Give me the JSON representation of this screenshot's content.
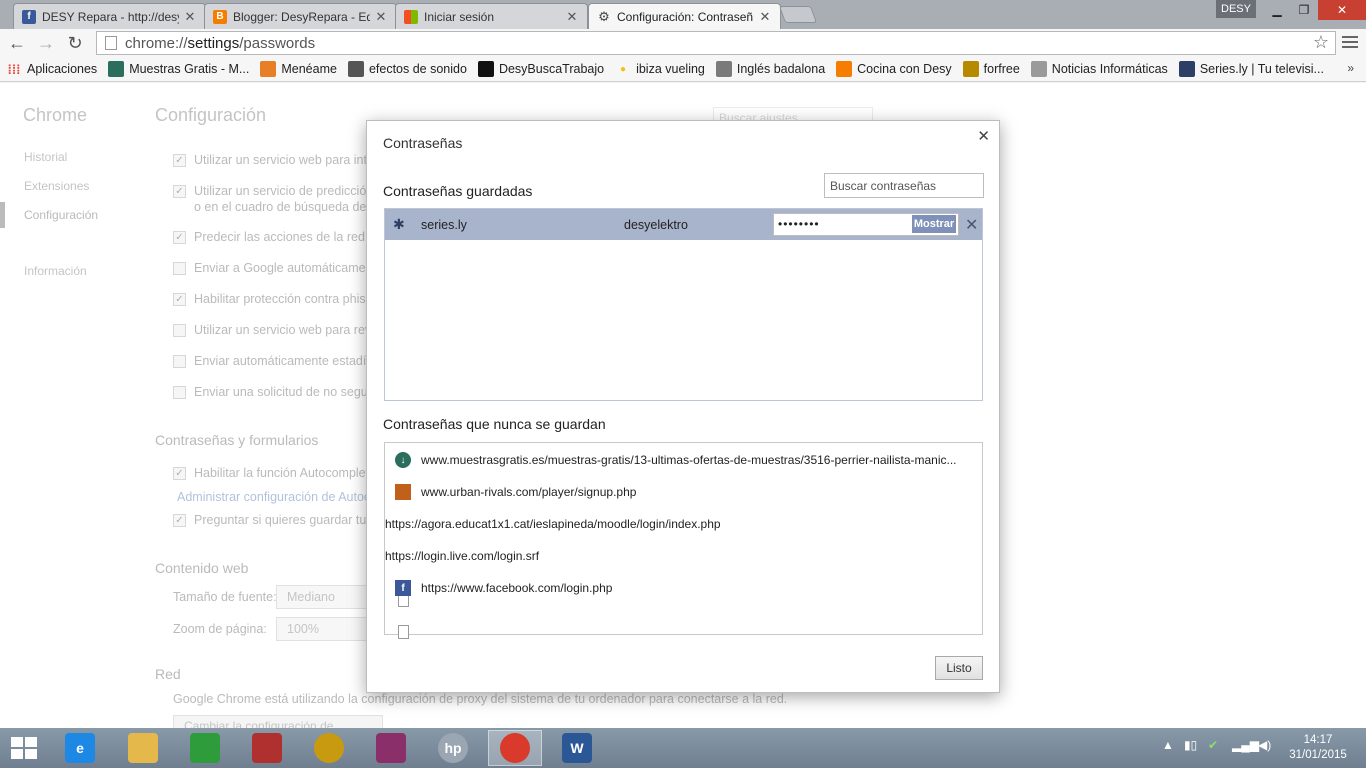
{
  "tabs": [
    {
      "title": "DESY Repara - http://desy",
      "icon": "facebook-icon",
      "color": "#3b5998",
      "active": false
    },
    {
      "title": "Blogger: DesyRepara - Edit",
      "icon": "blogger-icon",
      "color": "#f57d00",
      "active": false
    },
    {
      "title": "Iniciar sesión",
      "icon": "microsoft-icon",
      "color": "#0078d7",
      "active": false
    },
    {
      "title": "Configuración: Contraseñ",
      "icon": "gear-icon",
      "color": "#555555",
      "active": true
    }
  ],
  "profile_name": "DESY",
  "address": {
    "scheme": "chrome://",
    "host": "settings",
    "path": "/passwords"
  },
  "bookmarks": [
    {
      "label": "Aplicaciones",
      "icon": "apps-grid-icon",
      "color": "#e94235"
    },
    {
      "label": "Muestras Gratis - M...",
      "icon": "muestras-icon",
      "color": "#2b6e5e"
    },
    {
      "label": "Menéame",
      "icon": "meneame-icon",
      "color": "#e67f26"
    },
    {
      "label": "efectos de sonido",
      "icon": "sound-icon",
      "color": "#555555"
    },
    {
      "label": "DesyBuscaTrabajo",
      "icon": "black-square-icon",
      "color": "#111111"
    },
    {
      "label": "ibiza vueling",
      "icon": "yellow-dot-icon",
      "color": "#f4c20d"
    },
    {
      "label": "Inglés badalona",
      "icon": "english-icon",
      "color": "#7a7a7a"
    },
    {
      "label": "Cocina con Desy",
      "icon": "blogger-icon",
      "color": "#f57d00"
    },
    {
      "label": "forfree",
      "icon": "crown-icon",
      "color": "#b58a00"
    },
    {
      "label": "Noticias Informáticas",
      "icon": "page-icon",
      "color": "#9a9a9a"
    },
    {
      "label": "Series.ly | Tu televisi...",
      "icon": "seriesly-icon",
      "color": "#2d3f66"
    }
  ],
  "sidebar": {
    "brand": "Chrome",
    "items": [
      {
        "label": "Historial"
      },
      {
        "label": "Extensiones"
      },
      {
        "label": "Configuración"
      },
      {
        "label": "Información"
      }
    ]
  },
  "settings": {
    "title": "Configuración",
    "search_placeholder": "Buscar ajustes",
    "privacy_options": [
      {
        "label": "Utilizar un servicio web para inte",
        "checked": true
      },
      {
        "label": "Utilizar un servicio de predicción",
        "label2": "o en el cuadro de búsqueda del",
        "checked": true
      },
      {
        "label": "Predecir las acciones de la red pa",
        "checked": true
      },
      {
        "label": "Enviar a Google automáticament",
        "checked": false
      },
      {
        "label": "Habilitar protección contra phish",
        "checked": true
      },
      {
        "label": "Utilizar un servicio web para revi",
        "checked": false
      },
      {
        "label": "Enviar automáticamente estadíst",
        "checked": false
      },
      {
        "label": "Enviar una solicitud de no segui",
        "checked": false
      }
    ],
    "passwords_section": "Contraseñas y formularios",
    "autofill_option": "Habilitar la función Autocomplet",
    "autofill_link": "Administrar configuración de Autoc",
    "save_pw_option": "Preguntar si quieres guardar tus",
    "web_content_section": "Contenido web",
    "font_size_label": "Tamaño de fuente:",
    "font_size_value": "Mediano",
    "zoom_label": "Zoom de página:",
    "zoom_value": "100%",
    "network_section": "Red",
    "network_note": "Google Chrome está utilizando la configuración de proxy del sistema de tu ordenador para conectarse a la red.",
    "proxy_button": "Cambiar la configuración de proxy..."
  },
  "dialog": {
    "title": "Contraseñas",
    "saved_heading": "Contraseñas guardadas",
    "search_placeholder": "Buscar contraseñas",
    "saved": [
      {
        "site": "series.ly",
        "username": "desyelektro",
        "password_mask": "••••••••",
        "show_label": "Mostrar"
      }
    ],
    "never_heading": "Contraseñas que nunca se guardan",
    "never_saved": [
      {
        "url": "www.muestrasgratis.es/muestras-gratis/13-ultimas-ofertas-de-muestras/3516-perrier-nailista-manic...",
        "icon": "muestras-icon",
        "color": "#2b6e5e"
      },
      {
        "url": "www.urban-rivals.com/player/signup.php",
        "icon": "urban-rivals-icon",
        "color": "#c0601a"
      },
      {
        "url": "https://agora.educat1x1.cat/ieslapineda/moodle/login/index.php",
        "icon": "page-icon",
        "color": "#ffffff"
      },
      {
        "url": "https://login.live.com/login.srf",
        "icon": "page-icon",
        "color": "#ffffff"
      },
      {
        "url": "https://www.facebook.com/login.php",
        "icon": "facebook-icon",
        "color": "#3b5998"
      }
    ],
    "ok_label": "Listo"
  },
  "taskbar": {
    "apps": [
      {
        "name": "internet-explorer-icon",
        "glyph": "e",
        "color": "#1e88e5"
      },
      {
        "name": "file-explorer-icon",
        "glyph": "",
        "color": "#e5b84c"
      },
      {
        "name": "store-icon",
        "glyph": "",
        "color": "#2e9c3a"
      },
      {
        "name": "puzzle-app-icon",
        "glyph": "",
        "color": "#b03030"
      },
      {
        "name": "media-app-icon",
        "glyph": "",
        "color": "#c89a10"
      },
      {
        "name": "projector-app-icon",
        "glyph": "",
        "color": "#8b2f6b"
      },
      {
        "name": "hp-icon",
        "glyph": "hp",
        "color": "#9aa6b2"
      },
      {
        "name": "chrome-icon",
        "glyph": "",
        "color": "#d93a2b"
      },
      {
        "name": "word-icon",
        "glyph": "W",
        "color": "#2b5797"
      }
    ],
    "time": "14:17",
    "date": "31/01/2015"
  }
}
